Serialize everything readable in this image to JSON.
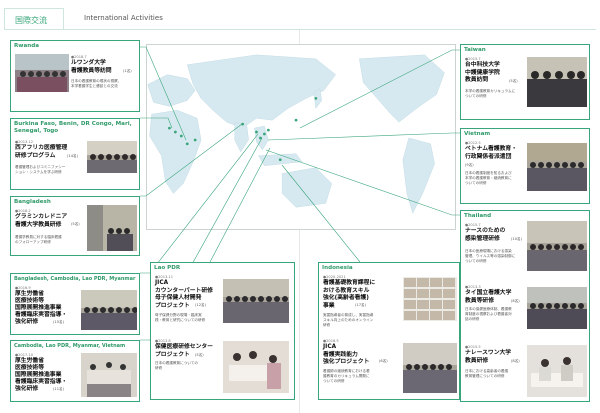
{
  "header": {
    "title_jp": "国際交流",
    "title_en": "International Activities"
  },
  "cards": {
    "rwanda": {
      "country": "Rwanda",
      "date": "●2018.7",
      "title": "ルワンダ大学\n看護教員等訪問",
      "tag": "(1名)",
      "desc": "日本の看護教育の現状の視察、\n本学看護学生と懇談との交流"
    },
    "burkina": {
      "country": "Burkina Faso, Benin, DR Congo, Mari,\nSenegal, Togo",
      "date": "●2013.12",
      "title": "西アフリカ医療管理\n研修プログラム",
      "tag": "(14名)",
      "desc": "看護管理およびコミニファシー\nション・システムを学ぶ研修"
    },
    "bangladesh": {
      "country": "Bangladesh",
      "date": "●2018.2",
      "title": "グラミンカレドニア\n看護大学教員研修",
      "tag": "(5名)",
      "desc": "看護学教員に対する臨床看護\nのフォローアップ研修"
    },
    "bcl": {
      "country": "Bangladesh, Cambodia, Lao PDR, Myanmar",
      "date": "●2016.9",
      "title": "厚生労働省\n医療技術等\n国際展開推進事業\n看護臨床実習指導・\n強化研修",
      "tag": "(15名)"
    },
    "clmv": {
      "country": "Cambodia, Lao PDR, Myanmar, Vietnam",
      "date": "●2017.10",
      "title": "厚生労働省\n医療技術等\n国際展開推進事業\n看護臨床実習指導・\n強化研修",
      "tag": "(11名)"
    },
    "lao": {
      "country": "Lao PDR",
      "date1": "●2013.11",
      "title1": "JICA\nカウンターパート研修\n母子保健人材開発\nプロジェクト",
      "tag1": "(12名)",
      "desc1": "母子保健分野の現場・臨床実\n践・教育と研究についての研修",
      "date2": "●2013.8",
      "title2": "保健医療研修センター\nプロジェクト",
      "tag2": "(5名)",
      "desc2": "日本の看護教育についての\n研修"
    },
    "indonesia": {
      "country": "Indonesia",
      "date1": "●2020-2021",
      "title1": "看護基礎教育課程に\nおける教育スキル\n強化(高齢者看護)\n事業",
      "tag1": "(17名)",
      "desc1": "実習指導者の育成し、実習指導\nスキル向上のためのオンライン\n研修",
      "date2": "●2016.5",
      "title2": "JICA\n看護実践能力\n強化プロジェクト",
      "tag2": "(6名)",
      "desc2": "看護師の継続教育における看\n護教育のカリキュラム開発に\nついての研修"
    },
    "taiwan": {
      "country": "Taiwan",
      "date": "●2015.7",
      "title": "台中科技大学\n中護健康学院\n教員訪問",
      "tag": "(5名)",
      "desc": "本学の看護教育カリキュラムに\nついての研修"
    },
    "vietnam": {
      "country": "Vietnam",
      "date": "●2012.5",
      "title": "ベトナム看護教育・\n行政関係者派遣団",
      "tag": "(9名)",
      "desc": "日本の看護制度を知るおよび\n本学の看護教育・継続教育に\nついての研修"
    },
    "thailand": {
      "country": "Thailand",
      "date1": "●2015.7",
      "title1": "ナースのための\n感染管理研修",
      "tag1": "(10名)",
      "desc1": "日本の医療現場における感染\n管理、ウイルス等の感染制御に\nついての研修",
      "date2": "●2013.3",
      "title2": "タイ国立看護大学\n教員等研修",
      "tag2": "(8名)",
      "desc2": "日本の保健医療体制、看護教\n育制度の視察および看護者対\n話の研修",
      "date3": "●2015.5",
      "title3": "ナレースワン大学\n教員研修",
      "tag3": "(8名)",
      "desc3": "日本における高齢者の看護\n教育管理についての研修"
    }
  },
  "colors": {
    "accent": "#3aa57a",
    "land": "#d6e9f0",
    "line": "#3aa57a"
  }
}
